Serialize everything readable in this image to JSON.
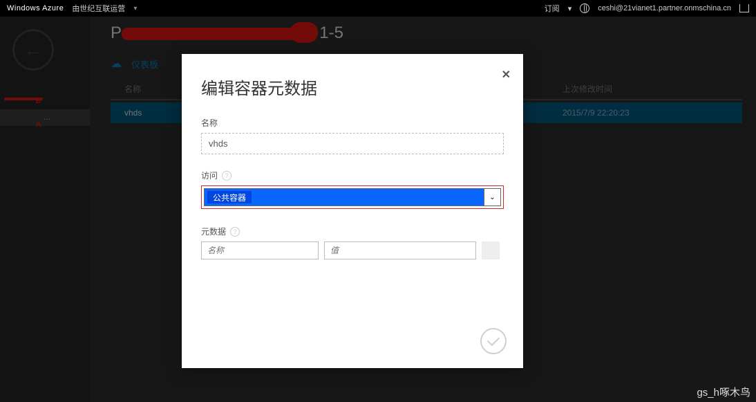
{
  "topbar": {
    "brand": "Windows Azure",
    "subscription": "由世纪互联运营",
    "right_label": "订阅",
    "user_email": "ceshi@21vianet1.partner.onmschina.cn"
  },
  "sidebar": {
    "redacted_b": "B",
    "redacted_a": "A",
    "ellipsis": "…"
  },
  "content": {
    "title_prefix": "P",
    "title_suffix": "1-5",
    "tab_dashboard": "仪表板",
    "col_name": "名称",
    "col_modified": "上次修改时间",
    "row": {
      "name": "vhds",
      "date": "2015/7/9 22:20:23"
    }
  },
  "modal": {
    "title": "编辑容器元数据",
    "labels": {
      "name": "名称",
      "access": "访问",
      "metadata": "元数据"
    },
    "name_value": "vhds",
    "access_value": "公共容器",
    "meta_name_ph": "名称",
    "meta_value_ph": "值"
  },
  "watermark": "gs_h啄木鸟"
}
